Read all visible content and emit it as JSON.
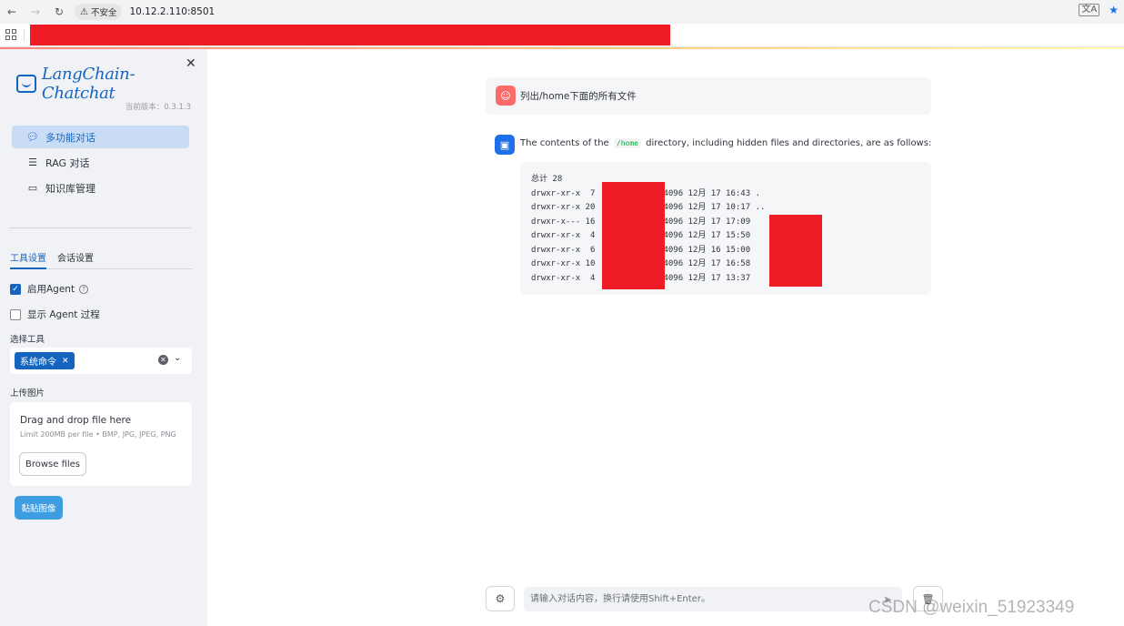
{
  "browser": {
    "security_label": "不安全",
    "url": "10.12.2.110:8501"
  },
  "sidebar": {
    "logo_text": "LangChain-Chatchat",
    "version": "当前版本：0.3.1.3",
    "nav": [
      {
        "label": "多功能对话"
      },
      {
        "label": "RAG 对话"
      },
      {
        "label": "知识库管理"
      }
    ],
    "tabs": [
      {
        "label": "工具设置"
      },
      {
        "label": "会话设置"
      }
    ],
    "enable_agent_label": "启用Agent",
    "show_agent_process_label": "显示 Agent 过程",
    "select_tools_label": "选择工具",
    "selected_tool": "系统命令",
    "upload_label": "上传图片",
    "uploader": {
      "title": "Drag and drop file here",
      "limit": "Limit 200MB per file • BMP, JPG, JPEG, PNG",
      "browse_label": "Browse files"
    },
    "paste_label": "黏贴图像"
  },
  "chat": {
    "user_message": "列出/home下面的所有文件",
    "bot_text_before": "The contents of the",
    "bot_code": "/home",
    "bot_text_after": "directory, including hidden files and directories, are as follows:",
    "code_lines": [
      {
        "left": "总计 28",
        "right": ""
      },
      {
        "left": "drwxr-xr-x  7",
        "right": "4096 12月 17 16:43 ."
      },
      {
        "left": "drwxr-xr-x 20",
        "right": "4096 12月 17 10:17 .."
      },
      {
        "left": "drwxr-x--- 16",
        "right": "4096 12月 17 17:09"
      },
      {
        "left": "drwxr-xr-x  4",
        "right": "4096 12月 17 15:50"
      },
      {
        "left": "drwxr-xr-x  6",
        "right": "4096 12月 16 15:00"
      },
      {
        "left": "drwxr-xr-x 10",
        "right": "4096 12月 17 16:58"
      },
      {
        "left": "drwxr-xr-x  4",
        "right": "4096 12月 17 13:37"
      }
    ],
    "input_placeholder": "请输入对话内容，换行请使用Shift+Enter。"
  },
  "watermark": "CSDN @weixin_51923349",
  "colors": {
    "accent": "#1565c0",
    "redaction": "#ee1c25",
    "sidebar_bg": "#f0f2f6",
    "user_avatar": "#ff6b6b",
    "bot_avatar": "#1f6fe8"
  }
}
